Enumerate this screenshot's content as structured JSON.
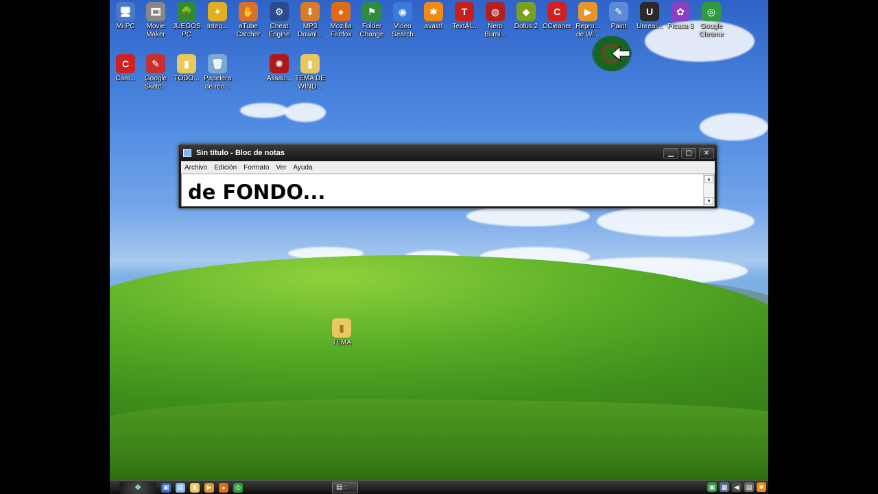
{
  "desktop": {
    "row1": [
      {
        "label": "Mi PC",
        "icon": "computer-icon",
        "glyph": "🖥",
        "color": "#4a78c8"
      },
      {
        "label": "Movie Maker",
        "icon": "film-reel-icon",
        "glyph": "🎞",
        "color": "#888888"
      },
      {
        "label": "JUEGOS PC",
        "icon": "tree-icon",
        "glyph": "🌳",
        "color": "#2f8c2f"
      },
      {
        "label": "Integ...",
        "icon": "gamepad-icon",
        "glyph": "✦",
        "color": "#e0b020"
      },
      {
        "label": "aTube Catcher",
        "icon": "baseball-glove-icon",
        "glyph": "✋",
        "color": "#d8702a"
      },
      {
        "label": "Cheat Engine",
        "icon": "gear-engine-icon",
        "glyph": "⚙",
        "color": "#2a4c8c"
      },
      {
        "label": "MP3 Downl...",
        "icon": "mp3-download-icon",
        "glyph": "⬇",
        "color": "#d87a2a"
      },
      {
        "label": "Mozilla Firefox",
        "icon": "firefox-icon",
        "glyph": "●",
        "color": "#e36a14"
      },
      {
        "label": "Folder Change",
        "icon": "folder-flag-icon",
        "glyph": "⚑",
        "color": "#2f8c3f"
      },
      {
        "label": "Video Search",
        "icon": "globe-search-icon",
        "glyph": "◉",
        "color": "#3a7ad8"
      },
      {
        "label": "avast!",
        "icon": "avast-icon",
        "glyph": "✱",
        "color": "#f08a10"
      },
      {
        "label": "TextAl...",
        "icon": "text-aloud-icon",
        "glyph": "T",
        "color": "#c81e1e"
      },
      {
        "label": "Nero Burni...",
        "icon": "nero-icon",
        "glyph": "◍",
        "color": "#b02020"
      },
      {
        "label": "Dofus 2",
        "icon": "dofus-egg-icon",
        "glyph": "◆",
        "color": "#7aa020"
      },
      {
        "label": "CCleaner",
        "icon": "ccleaner-icon",
        "glyph": "C",
        "color": "#d02020"
      },
      {
        "label": "Repro... de Wi...",
        "icon": "media-player-icon",
        "glyph": "▶",
        "color": "#e8962a"
      },
      {
        "label": "Paint",
        "icon": "paint-brush-icon",
        "glyph": "✎",
        "color": "#5a8ad8"
      },
      {
        "label": "Unreal...",
        "icon": "unreal-icon",
        "glyph": "U",
        "color": "#2a2a2a"
      },
      {
        "label": "Picasa 3",
        "icon": "picasa-icon",
        "glyph": "✿",
        "color": "#8a40c0"
      },
      {
        "label": "Google Chrome",
        "icon": "chrome-icon",
        "glyph": "◎",
        "color": "#2f9a3f"
      }
    ],
    "row2": [
      {
        "label": "Cam...",
        "icon": "camtasia-icon",
        "glyph": "C",
        "color": "#d02020"
      },
      {
        "label": "Google Sketc...",
        "icon": "sketchup-icon",
        "glyph": "✎",
        "color": "#c83030"
      },
      {
        "label": "TODO...",
        "icon": "folder-icon",
        "glyph": "▮",
        "color": "#e8c860"
      },
      {
        "label": "Papelera de rec...",
        "icon": "recycle-bin-icon",
        "glyph": "🗑",
        "color": "#7aa8d0"
      },
      {
        "label": "Assau...",
        "icon": "assault-icon",
        "glyph": "✺",
        "color": "#b01818"
      },
      {
        "label": "TEMA DE WIND...",
        "icon": "folder-icon",
        "glyph": "▮",
        "color": "#e8c860"
      }
    ],
    "loose": {
      "label": "TEMA",
      "icon": "folder-icon",
      "glyph": "▮",
      "color": "#e8c860"
    }
  },
  "notepad": {
    "title": "Sin título - Bloc de notas",
    "menu": [
      "Archivo",
      "Edición",
      "Formato",
      "Ver",
      "Ayuda"
    ],
    "content": "de FONDO..."
  },
  "taskbar": {
    "start_glyph": "❖",
    "task_glyph": "▤ :"
  }
}
